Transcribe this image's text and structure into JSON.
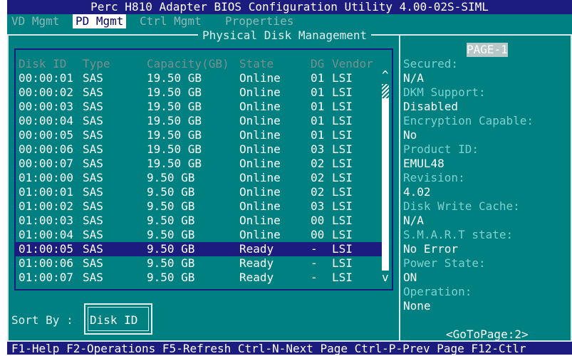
{
  "window": {
    "title": "Perc H810 Adapter BIOS Configuration Utility 4.00-02S-SIML"
  },
  "tabs": [
    {
      "label": "VD Mgmt",
      "active": false
    },
    {
      "label": "PD Mgmt",
      "active": true
    },
    {
      "label": "Ctrl Mgmt",
      "active": false
    },
    {
      "label": "Properties",
      "active": false
    }
  ],
  "panel": {
    "title": "Physical Disk Management"
  },
  "table": {
    "headers": [
      "Disk ID",
      "Type",
      "Capacity(GB)",
      "State",
      "DG",
      "Vendor"
    ],
    "rows": [
      [
        "00:00:01",
        "SAS",
        "19.50 GB",
        "Online",
        "01",
        "LSI"
      ],
      [
        "00:00:02",
        "SAS",
        "19.50 GB",
        "Online",
        "01",
        "LSI"
      ],
      [
        "00:00:03",
        "SAS",
        "19.50 GB",
        "Online",
        "01",
        "LSI"
      ],
      [
        "00:00:04",
        "SAS",
        "19.50 GB",
        "Online",
        "01",
        "LSI"
      ],
      [
        "00:00:05",
        "SAS",
        "19.50 GB",
        "Online",
        "01",
        "LSI"
      ],
      [
        "00:00:06",
        "SAS",
        "19.50 GB",
        "Online",
        "03",
        "LSI"
      ],
      [
        "00:00:07",
        "SAS",
        "19.50 GB",
        "Online",
        "02",
        "LSI"
      ],
      [
        "01:00:00",
        "SAS",
        "9.50 GB",
        "Online",
        "02",
        "LSI"
      ],
      [
        "01:00:01",
        "SAS",
        "9.50 GB",
        "Online",
        "02",
        "LSI"
      ],
      [
        "01:00:02",
        "SAS",
        "9.50 GB",
        "Online",
        "03",
        "LSI"
      ],
      [
        "01:00:03",
        "SAS",
        "9.50 GB",
        "Online",
        "00",
        "LSI"
      ],
      [
        "01:00:04",
        "SAS",
        "9.50 GB",
        "Online",
        "00",
        "LSI"
      ],
      [
        "01:00:05",
        "SAS",
        "9.50 GB",
        "Ready",
        "-",
        "LSI"
      ],
      [
        "01:00:06",
        "SAS",
        "9.50 GB",
        "Ready",
        "-",
        "LSI"
      ],
      [
        "01:00:07",
        "SAS",
        "9.50 GB",
        "Ready",
        "-",
        "LSI"
      ]
    ],
    "selected_index": 12,
    "scroll_up": "^",
    "scroll_down": "v"
  },
  "sort": {
    "label": "Sort By :",
    "value": "Disk ID"
  },
  "details": {
    "page": "PAGE-1",
    "items": [
      {
        "key": "Secured:",
        "value": "N/A"
      },
      {
        "key": "DKM Support:",
        "value": "Disabled"
      },
      {
        "key": "Encryption Capable:",
        "value": "No"
      },
      {
        "key": "Product ID:",
        "value": "EMUL48"
      },
      {
        "key": "Revision:",
        "value": "4.02"
      },
      {
        "key": "Disk Write Cache:",
        "value": "N/A"
      },
      {
        "key": "S.M.A.R.T state:",
        "value": "No Error"
      },
      {
        "key": "Power State:",
        "value": "ON"
      },
      {
        "key": "Operation:",
        "value": "None"
      }
    ],
    "goto": "<GoToPage:2>"
  },
  "footer": {
    "text": "F1-Help F2-Operations F5-Refresh Ctrl-N-Next Page Ctrl-P-Prev Page F12-Ctlr"
  },
  "colors": {
    "background": "#008080",
    "selection": "#1c1c7e",
    "key_text": "#7fd0d0"
  }
}
